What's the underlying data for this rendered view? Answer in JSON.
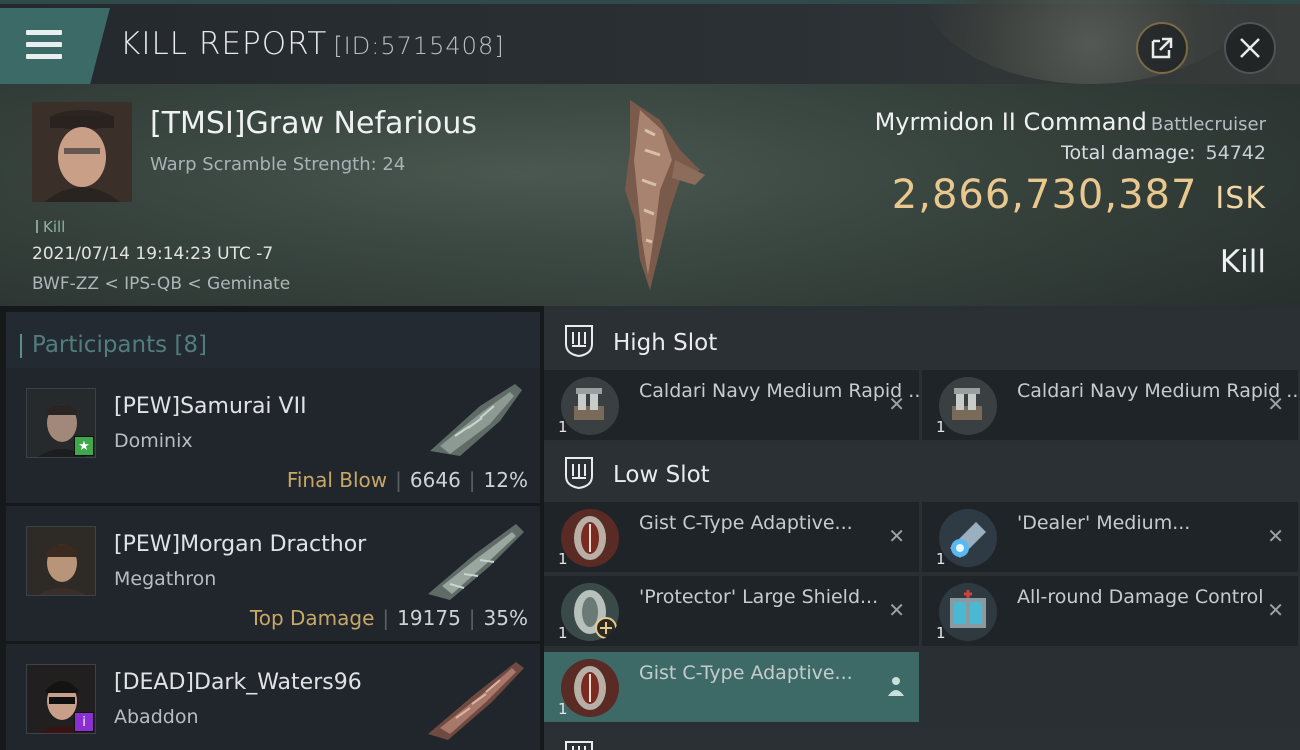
{
  "header": {
    "title": "KILL REPORT",
    "report_id": "[ID:5715408]"
  },
  "victim": {
    "name": "[TMSI]Graw Nefarious",
    "warp_scramble": "Warp Scramble Strength: 24",
    "tag": "Kill",
    "datetime": "2021/07/14 19:14:23 UTC -7",
    "location": "BWF-ZZ < IPS-QB < Geminate",
    "ship_name": "Myrmidon II Command",
    "ship_class": "Battlecruiser",
    "total_damage_label": "Total damage:",
    "total_damage": "54742",
    "isk_value": "2,866,730,387",
    "isk_unit": "ISK",
    "result": "Kill"
  },
  "participants": {
    "title": "Participants",
    "count": "[8]",
    "items": [
      {
        "name": "[PEW]Samurai VII",
        "ship": "Dominix",
        "label": "Final Blow",
        "damage": "6646",
        "percent": "12%",
        "badge_color": "#3fa84a",
        "badge_icon": "star-icon"
      },
      {
        "name": "[PEW]Morgan Dracthor",
        "ship": "Megathron",
        "label": "Top Damage",
        "damage": "19175",
        "percent": "35%",
        "badge_color": "",
        "badge_icon": ""
      },
      {
        "name": "[DEAD]Dark_Waters96",
        "ship": "Abaddon",
        "label": "",
        "damage": "",
        "percent": "",
        "badge_color": "#8a2fd0",
        "badge_icon": "info-icon"
      }
    ]
  },
  "fittings": {
    "high_slot_label": "High Slot",
    "low_slot_label": "Low Slot",
    "high": [
      {
        "name": "Caldari Navy Medium Rapid ...",
        "qty": "1"
      },
      {
        "name": "Caldari Navy Medium Rapid ...",
        "qty": "1"
      }
    ],
    "low": [
      {
        "name": "Gist C-Type Adaptive...",
        "qty": "1"
      },
      {
        "name": "'Dealer' Medium...",
        "qty": "1"
      },
      {
        "name": "'Protector' Large Shield...",
        "qty": "1"
      },
      {
        "name": "All-round Damage Control",
        "qty": "1"
      },
      {
        "name": "Gist C-Type Adaptive...",
        "qty": "1"
      }
    ]
  },
  "colors": {
    "accent_teal": "#3d6a67",
    "isk_gold": "#e8c88e",
    "label_gold": "#c9a767"
  }
}
